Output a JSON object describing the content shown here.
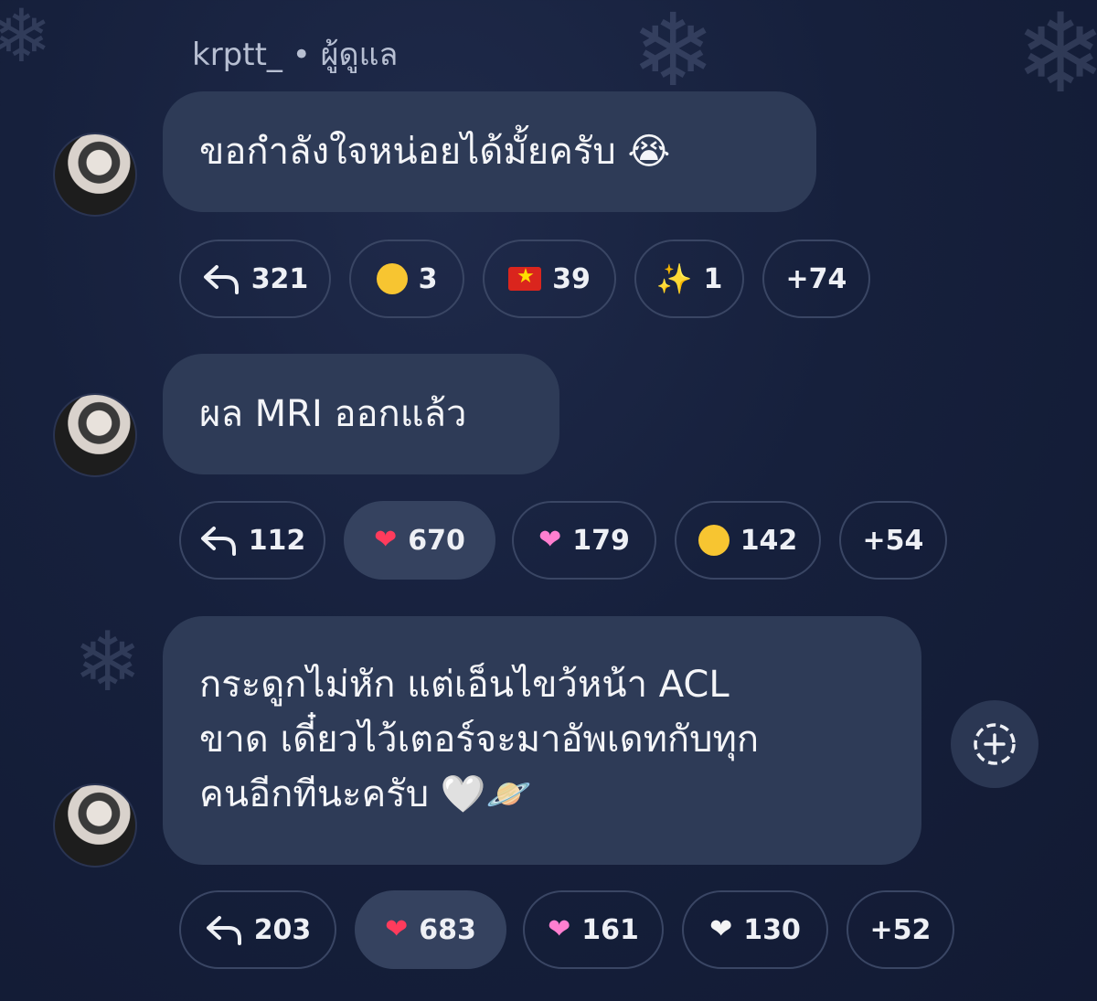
{
  "sender": {
    "name": "krptt_",
    "role": "• ผู้ดูแล"
  },
  "messages": [
    {
      "lines": [
        "ขอกำลังใจหน่อยได้มั้ยครับ 😭"
      ],
      "reactions": [
        {
          "type": "reply",
          "icon": "reply-icon",
          "count": "321",
          "active": false
        },
        {
          "type": "emoji",
          "icon": "smiling-face-icon",
          "count": "3",
          "active": false
        },
        {
          "type": "emoji",
          "icon": "vietnam-flag-icon",
          "count": "39",
          "active": false
        },
        {
          "type": "emoji",
          "icon": "sparkles-icon",
          "count": "1",
          "active": false
        },
        {
          "type": "more",
          "label": "+74",
          "active": false
        }
      ]
    },
    {
      "lines": [
        "ผล MRI ออกแล้ว"
      ],
      "reactions": [
        {
          "type": "reply",
          "icon": "reply-icon",
          "count": "112",
          "active": false
        },
        {
          "type": "emoji",
          "icon": "red-heart-icon",
          "count": "670",
          "active": true
        },
        {
          "type": "emoji",
          "icon": "pink-heart-icon",
          "count": "179",
          "active": false
        },
        {
          "type": "emoji",
          "icon": "crying-face-icon",
          "count": "142",
          "active": false
        },
        {
          "type": "more",
          "label": "+54",
          "active": false
        }
      ]
    },
    {
      "lines": [
        "กระดูกไม่หัก แต่เอ็นไขว้หน้า ACL",
        "ขาด เดี๋ยวไว้เตอร์จะมาอัพเดทกับทุก",
        "คนอีกทีนะครับ 🤍🪐"
      ],
      "reactions": [
        {
          "type": "reply",
          "icon": "reply-icon",
          "count": "203",
          "active": false
        },
        {
          "type": "emoji",
          "icon": "red-heart-icon",
          "count": "683",
          "active": true
        },
        {
          "type": "emoji",
          "icon": "pink-heart-icon",
          "count": "161",
          "active": false
        },
        {
          "type": "emoji",
          "icon": "white-heart-icon",
          "count": "130",
          "active": false
        },
        {
          "type": "more",
          "label": "+52",
          "active": false
        }
      ]
    }
  ],
  "colors": {
    "bubble": "#2e3b57",
    "background": "#16203c",
    "chip_border": "#3a4664"
  }
}
